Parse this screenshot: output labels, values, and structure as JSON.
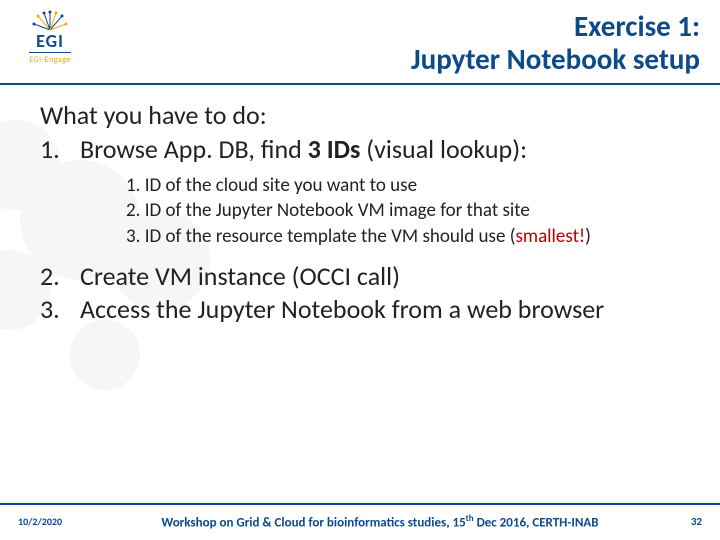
{
  "logo": {
    "main": "EGI",
    "sub": "EGI-Engage"
  },
  "title": {
    "l1": "Exercise 1:",
    "l2": "Jupyter Notebook setup"
  },
  "body": {
    "lead": "What you have to do:",
    "i1_num": "1.",
    "i1_a": "Browse App. DB, find ",
    "i1_b": "3 IDs",
    "i1_c": "  (visual lookup):",
    "s1": "1. ID of the cloud site you want to use",
    "s2": "2. ID of the Jupyter Notebook VM image for that site",
    "s3_a": "3. ID of the resource template the VM should use (",
    "s3_b": "smallest!",
    "s3_c": ")",
    "i2_num": "2.",
    "i2": "Create VM instance (OCCI call)",
    "i3_num": "3.",
    "i3": "Access the Jupyter Notebook from a web browser"
  },
  "footer": {
    "date": "10/2/2020",
    "text_a": "Workshop on Grid & Cloud for bioinformatics studies, 15",
    "text_sup": "th",
    "text_b": " Dec 2016, CERTH-INAB",
    "page": "32"
  }
}
